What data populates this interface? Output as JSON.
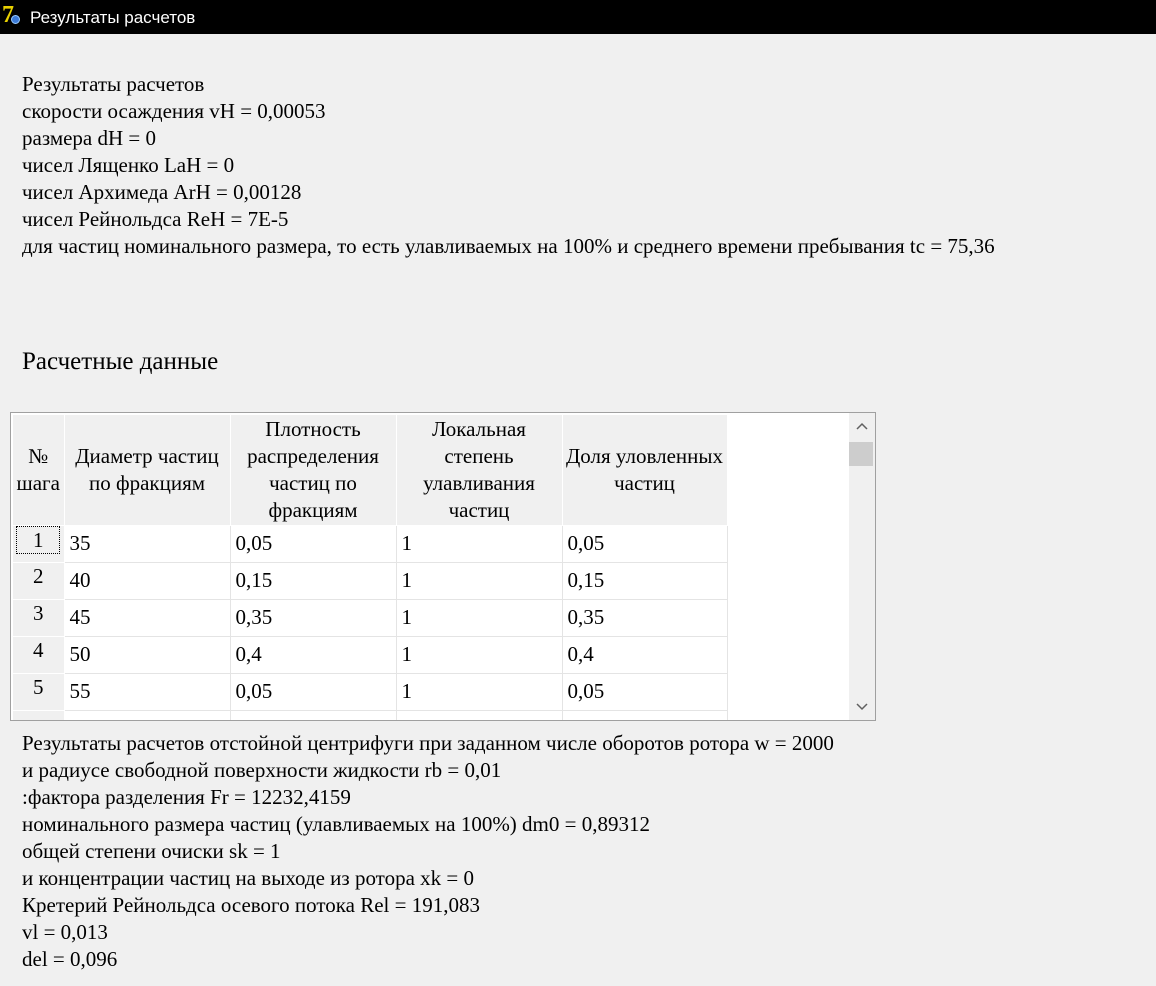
{
  "window": {
    "title": "Результаты расчетов",
    "icon": "app-icon"
  },
  "summary": {
    "lines": [
      "Результаты расчетов",
      "скорости осаждения vH = 0,00053",
      "размера dH = 0",
      "чисел Лященко LaH = 0",
      "чисел Архимеда ArH = 0,00128",
      "чисел Рейнольдса ReH = 7E-5",
      "для частиц номинального размера, то есть улавливаемых на 100% и среднего времени пребывания tc = 75,36"
    ]
  },
  "section": {
    "heading": "Расчетные данные"
  },
  "grid": {
    "columns": [
      "№ шага",
      "Диаметр частиц по фракциям",
      "Плотность распределения частиц по фракциям",
      "Локальная степень улавливания частиц",
      "Доля уловленных частиц"
    ],
    "rows": [
      {
        "n": "1",
        "diameter": "35",
        "density": "0,05",
        "local": "1",
        "share": "0,05"
      },
      {
        "n": "2",
        "diameter": "40",
        "density": "0,15",
        "local": "1",
        "share": "0,15"
      },
      {
        "n": "3",
        "diameter": "45",
        "density": "0,35",
        "local": "1",
        "share": "0,35"
      },
      {
        "n": "4",
        "diameter": "50",
        "density": "0,4",
        "local": "1",
        "share": "0,4"
      },
      {
        "n": "5",
        "diameter": "55",
        "density": "0,05",
        "local": "1",
        "share": "0,05"
      }
    ],
    "scroll_up_icon": "chevron-up-icon",
    "scroll_down_icon": "chevron-down-icon"
  },
  "results": {
    "lines": [
      "Результаты расчетов отстойной центрифуги при заданном числе оборотов ротора w = 2000",
      "и радиусе свободной поверхности жидкости rb = 0,01",
      ":фактора разделения Fr = 12232,4159",
      "номинального размера частиц (улавливаемых на 100%) dm0 = 0,89312",
      "общей степени очиски sk = 1",
      "и концентрации частиц на выходе из ротора xk = 0",
      "Кретерий Рейнольдса осевого потока Rel = 191,083",
      "vl = 0,013",
      "del = 0,096"
    ]
  }
}
